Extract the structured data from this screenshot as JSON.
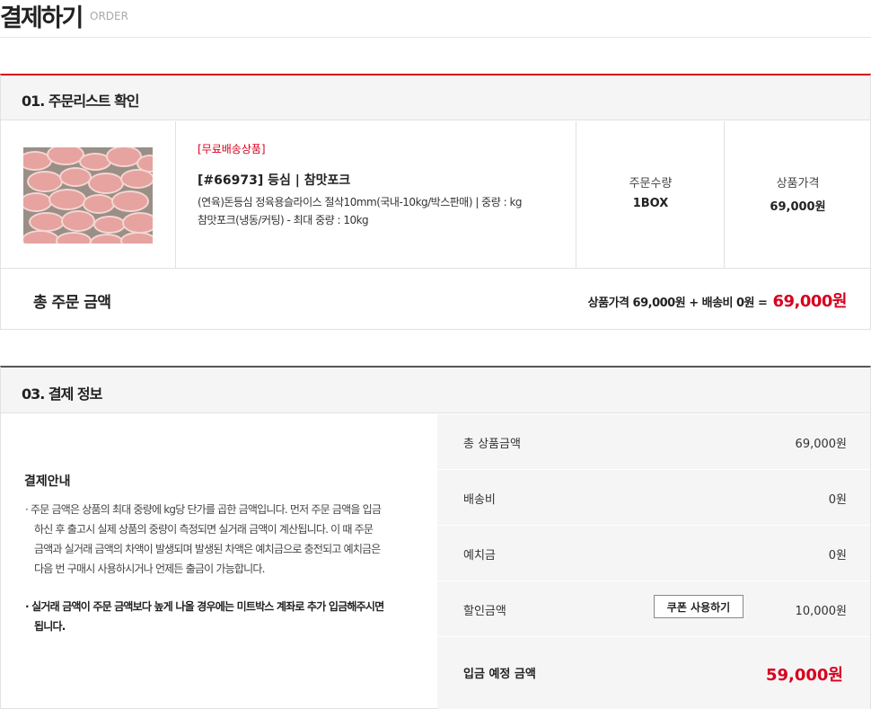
{
  "page": {
    "title": "결제하기",
    "subtitle": "ORDER"
  },
  "order_list": {
    "section_title": "01. 주문리스트 확인",
    "item": {
      "badge": "[무료배송상품]",
      "name": "[#66973] 등심 | 참맛포크",
      "desc_line1": "(연육)돈등심 정육용슬라이스 절삭10mm(국내-10kg/박스판매) | 중량 : kg",
      "desc_line2": "참맛포크(냉동/커팅) - 최대 중량 : 10kg",
      "qty_label": "주문수량",
      "qty_value": "1BOX",
      "price_label": "상품가격",
      "price_value": "69,000원"
    },
    "total": {
      "label": "총 주문 금액",
      "calc_text": "상품가격 69,000원 + 배송비 0원 =",
      "amount": "69,000원"
    }
  },
  "payment_info": {
    "section_title": "03. 결제 정보",
    "guide": {
      "title": "결제안내",
      "note1": "· 주문 금액은 상품의 최대 중량에 kg당 단가를 곱한 금액입니다. 먼저 주문 금액을 입금하신 후 출고시 실제 상품의 중량이 측정되면 실거래 금액이 계산됩니다. 이 때 주문 금액과 실거래 금액의 차액이 발생되며 발생된 차액은 예치금으로 충전되고 예치금은 다음 번 구매시 사용하시거나 언제든 출금이 가능합니다.",
      "note2": "· 실거래 금액이 주문 금액보다 높게 나올 경우에는 미트박스 계좌로 추가 입금해주시면 됩니다."
    },
    "rows": [
      {
        "label": "총 상품금액",
        "value": "69,000원"
      },
      {
        "label": "배송비",
        "value": "0원"
      },
      {
        "label": "예치금",
        "value": "0원"
      },
      {
        "label": "할인금액",
        "value": "10,000원",
        "button": "쿠폰 사용하기"
      }
    ],
    "final": {
      "label": "입금 예정 금액",
      "value": "59,000원"
    }
  },
  "colors": {
    "accent_red": "#d7001f",
    "panel_gray": "#f5f5f5",
    "border": "#e2e2e2"
  },
  "icons": {
    "product_image": "pork-loin-slices-image"
  }
}
